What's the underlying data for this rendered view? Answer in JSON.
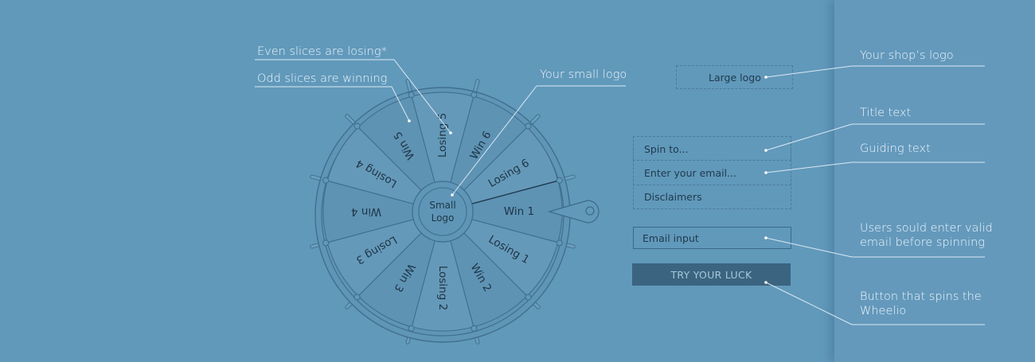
{
  "wheel": {
    "center_label": [
      "Small",
      "Logo"
    ],
    "slices": [
      "Win 1",
      "Losing 1",
      "Win 2",
      "Losing 2",
      "Win 3",
      "Losing 3",
      "Win 4",
      "Losing 4",
      "Win 5",
      "Losing 5",
      "Win 6",
      "Losing 6"
    ]
  },
  "form": {
    "large_logo": "Large logo",
    "title_text": "Spin to...",
    "guiding_text": "Enter your email...",
    "disclaimers": "Disclaimers",
    "email_input": "Email input",
    "button_label": "TRY YOUR LUCK"
  },
  "annotations": {
    "even_slices": "Even slices are losing*",
    "odd_slices": "Odd slices are winning",
    "small_logo": "Your small logo",
    "shop_logo": "Your shop’s logo",
    "title": "Title text",
    "guiding": "Guiding text",
    "email_line1": "Users sould enter valid",
    "email_line2": "email before spinning",
    "button_line1": "Button that spins the",
    "button_line2": "Wheelio"
  },
  "colors": {
    "background": "#6199bb",
    "wheel_stroke": "#3f6f8e",
    "button": "#3b6480",
    "annotation": "#eef6fb"
  }
}
